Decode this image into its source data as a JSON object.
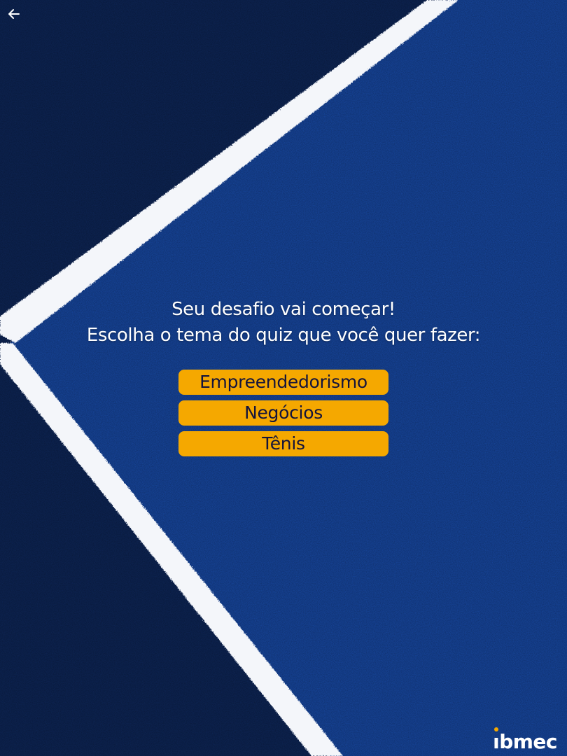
{
  "navigation": {
    "back_icon": "arrow-left-icon"
  },
  "prompt": {
    "line1": "Seu desafio vai começar!",
    "line2": "Escolha o tema do quiz que você quer fazer:"
  },
  "options": [
    {
      "label": "Empreendedorismo"
    },
    {
      "label": "Negócios"
    },
    {
      "label": "Tênis"
    }
  ],
  "logo": {
    "text": "ibmec",
    "first_letter": "ı",
    "rest": "bmec"
  },
  "colors": {
    "background_dark": "#0d2556",
    "court_blue": "#1747a0",
    "court_line": "#f4f6fa",
    "button": "#f5a800",
    "button_text": "#14143c",
    "logo_dot": "#f5a800"
  }
}
